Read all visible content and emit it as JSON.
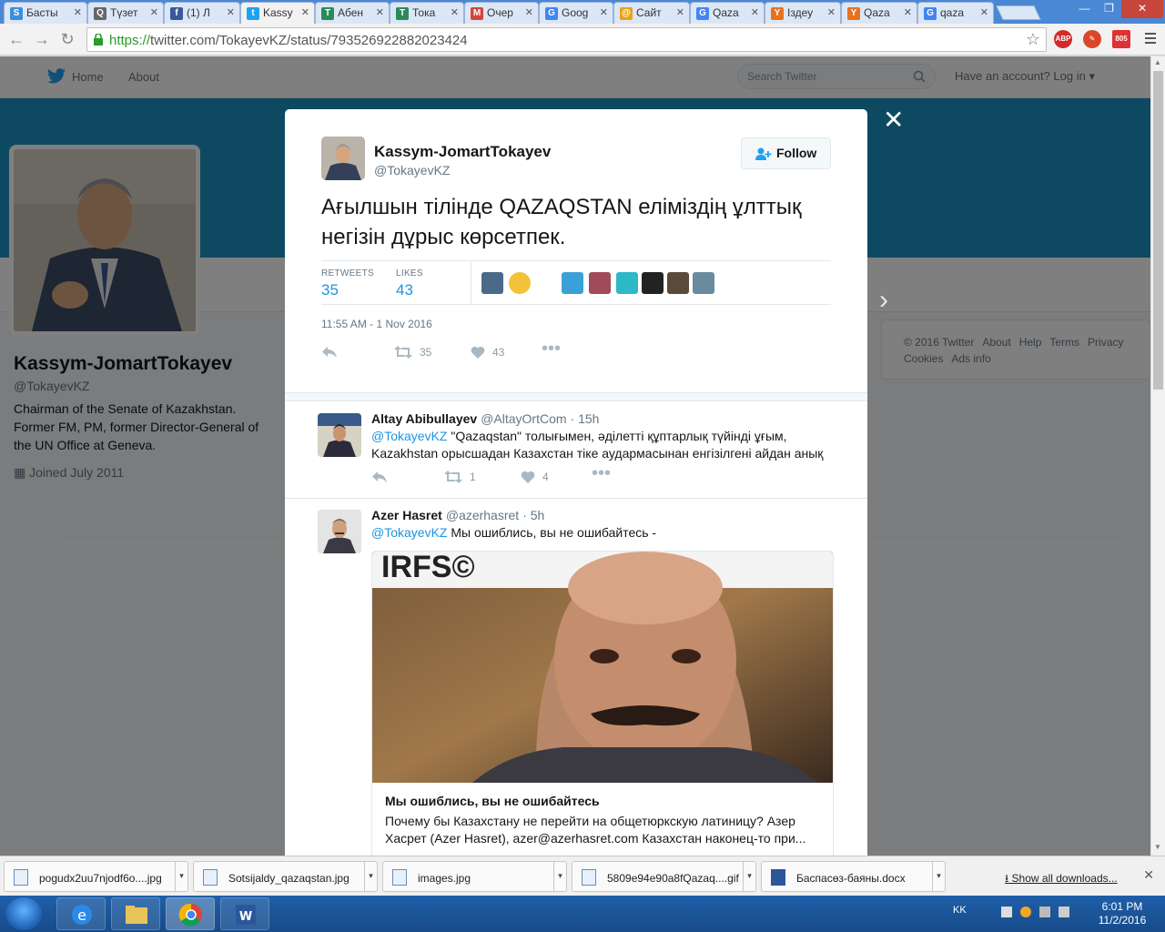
{
  "browser": {
    "tabs": [
      {
        "label": "Басты",
        "color": "#3b8fd8",
        "glyph": "S"
      },
      {
        "label": "Түзет",
        "color": "#666666",
        "glyph": "Q"
      },
      {
        "label": "(1) Л",
        "color": "#3b5998",
        "glyph": "f"
      },
      {
        "label": "Kassy",
        "color": "#1da1f2",
        "glyph": "t"
      },
      {
        "label": "Абен",
        "color": "#2a8a5a",
        "glyph": "T"
      },
      {
        "label": "Тока",
        "color": "#2a8a5a",
        "glyph": "T"
      },
      {
        "label": "Очер",
        "color": "#d44638",
        "glyph": "M"
      },
      {
        "label": "Goog",
        "color": "#4285f4",
        "glyph": "G"
      },
      {
        "label": "Сайт",
        "color": "#e8a317",
        "glyph": "@"
      },
      {
        "label": "Qaza",
        "color": "#4285f4",
        "glyph": "G"
      },
      {
        "label": "Іздеу",
        "color": "#e8721c",
        "glyph": "Y"
      },
      {
        "label": "Qaza",
        "color": "#e8721c",
        "glyph": "Y"
      },
      {
        "label": "qaza",
        "color": "#4285f4",
        "glyph": "G"
      }
    ],
    "url_scheme": "https://",
    "url_rest": "twitter.com/TokayevKZ/status/793526922882023424",
    "ext_abp": "ABP",
    "ext_mail_badge": "805"
  },
  "twitter_nav": {
    "home": "Home",
    "about": "About",
    "search_placeholder": "Search Twitter",
    "login": "Have an account? Log in"
  },
  "profile": {
    "name": "Kassym-JomartTokayev",
    "handle": "@TokayevKZ",
    "bio": "Chairman of the Senate of Kazakhstan. Former FM, PM, former Director-General of the UN Office at Geneva.",
    "joined": "Joined July 2011"
  },
  "footer_links": {
    "copyright": "© 2016 Twitter",
    "about": "About",
    "help": "Help",
    "terms": "Terms",
    "privacy": "Privacy",
    "cookies": "Cookies",
    "ads": "Ads info"
  },
  "tweet": {
    "author_name": "Kassym-JomartTokayev",
    "author_handle": "@TokayevKZ",
    "follow_label": "Follow",
    "text": "Ағылшын тілінде QAZAQSTAN еліміздің ұлттық негізін дұрыс көрсетпек.",
    "retweets_label": "RETWEETS",
    "retweets": "35",
    "likes_label": "LIKES",
    "likes": "43",
    "timestamp": "11:55 AM - 1 Nov 2016",
    "action_retweets": "35",
    "action_likes": "43"
  },
  "replies": [
    {
      "name": "Altay Abibullayev",
      "handle": "@AltayOrtCom",
      "time": "· 15h",
      "mention": "@TokayevKZ",
      "text": " \"Qazaqstan\" толығымен, әділетті құптарлық түйінді ұғым, Kazakhstan орысшадан Казахстан тіке аудармасынан енгізілгені айдан анық",
      "retweets": "1",
      "likes": "4"
    },
    {
      "name": "Azer Hasret",
      "handle": "@azerhasret",
      "time": "· 5h",
      "mention": "@TokayevKZ",
      "text": " Мы ошиблись, вы не ошибайтесь -"
    }
  ],
  "link_card": {
    "watermark": "IRFS©",
    "title": "Мы ошиблись, вы не ошибайтесь",
    "description": "Почему бы Казахстану не перейти на общетюркскую латиницу? Азер Хасрет (Azer Hasret), azer@azerhasret.com Казахстан наконец-то при..."
  },
  "downloads": [
    {
      "name": "pogudx2uu7njodf6o....jpg"
    },
    {
      "name": "Sotsijaldy_qazaqstan.jpg"
    },
    {
      "name": "images.jpg"
    },
    {
      "name": "5809e94e90a8fQazaq....gif"
    },
    {
      "name": "Баспасөз-баяны.docx"
    }
  ],
  "show_all_downloads": "Show all downloads...",
  "taskbar": {
    "lang": "KK",
    "time": "6:01 PM",
    "date": "11/2/2016"
  }
}
